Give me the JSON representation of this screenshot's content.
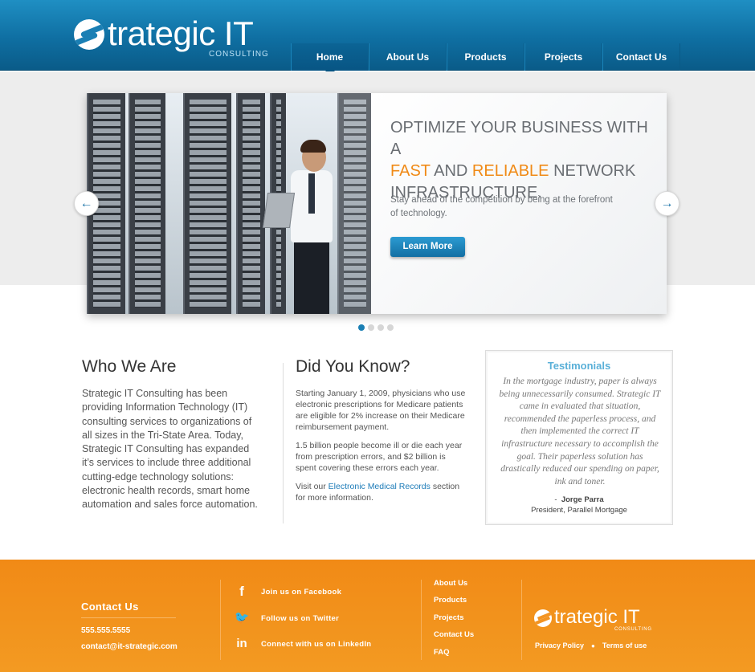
{
  "brand": {
    "logo_text": "trategic IT",
    "logo_sub": "CONSULTING"
  },
  "nav": {
    "items": [
      "Home",
      "About Us",
      "Products",
      "Projects",
      "Contact Us"
    ],
    "active": "Home"
  },
  "hero": {
    "title_line1": "OPTIMIZE YOUR BUSINESS WITH A",
    "title_fast": "FAST",
    "title_and": "AND",
    "title_reliable": "RELIABLE",
    "title_network": "NETWORK",
    "title_line3": "INFRASTRUCTURE.",
    "text": "Stay ahead of the competition by being at the forefront of technology.",
    "button_label": "Learn More",
    "prev_icon": "arrow-left-icon",
    "next_icon": "arrow-right-icon",
    "slide_count": 4,
    "active_slide": 1
  },
  "who": {
    "title": "Who We Are",
    "text": "Strategic IT Consulting has been providing Information Technology (IT) consulting services to organizations of all sizes in the Tri-State Area. Today, Strategic IT Consulting has expanded it’s services to include three additional cutting-edge technology solutions: electronic health records, smart home automation and sales force automation."
  },
  "did": {
    "title": "Did You Know?",
    "p1": "Starting January 1, 2009, physicians who use electronic prescriptions for Medicare patients are eligible for 2% increase on their Medicare reimbursement payment.",
    "p2": "1.5 billion people become ill or die each year from prescription errors, and $2 billion is spent covering these errors each year.",
    "p3_before": "Visit our",
    "p3_link": "Electronic Medical Records",
    "p3_after": "section for more information."
  },
  "testimonials": {
    "title": "Testimonials",
    "quote": "In the mortgage industry, paper is always being unnecessarily consumed. Strategic IT came in evaluated that situation, recommended the paperless process, and then implemented the correct IT infrastructure necessary to accomplish the goal. Their paperless solution has drastically reduced our spending on paper, ink and toner.",
    "author_prefix": "-",
    "author": "Jorge Parra",
    "role": "President, Parallel Mortgage"
  },
  "footer": {
    "contact_title": "Contact Us",
    "phone": "555.555.5555",
    "email": "contact@it-strategic.com",
    "social": [
      {
        "icon": "facebook-icon",
        "glyph": "f",
        "label": "Join us on Facebook"
      },
      {
        "icon": "twitter-icon",
        "glyph": "🐦",
        "label": "Follow us on Twitter"
      },
      {
        "icon": "linkedin-icon",
        "glyph": "in",
        "label": "Connect with us on LinkedIn"
      }
    ],
    "links": [
      "About Us",
      "Products",
      "Projects",
      "Contact Us",
      "FAQ"
    ],
    "logo_text": "trategic IT",
    "logo_sub": "CONSULTING",
    "privacy": "Privacy Policy",
    "terms": "Terms of use"
  },
  "colors": {
    "header_blue": "#0f6fa2",
    "accent_orange": "#f08a16",
    "footer_orange": "#f39422",
    "link_blue": "#1c7bb8"
  }
}
